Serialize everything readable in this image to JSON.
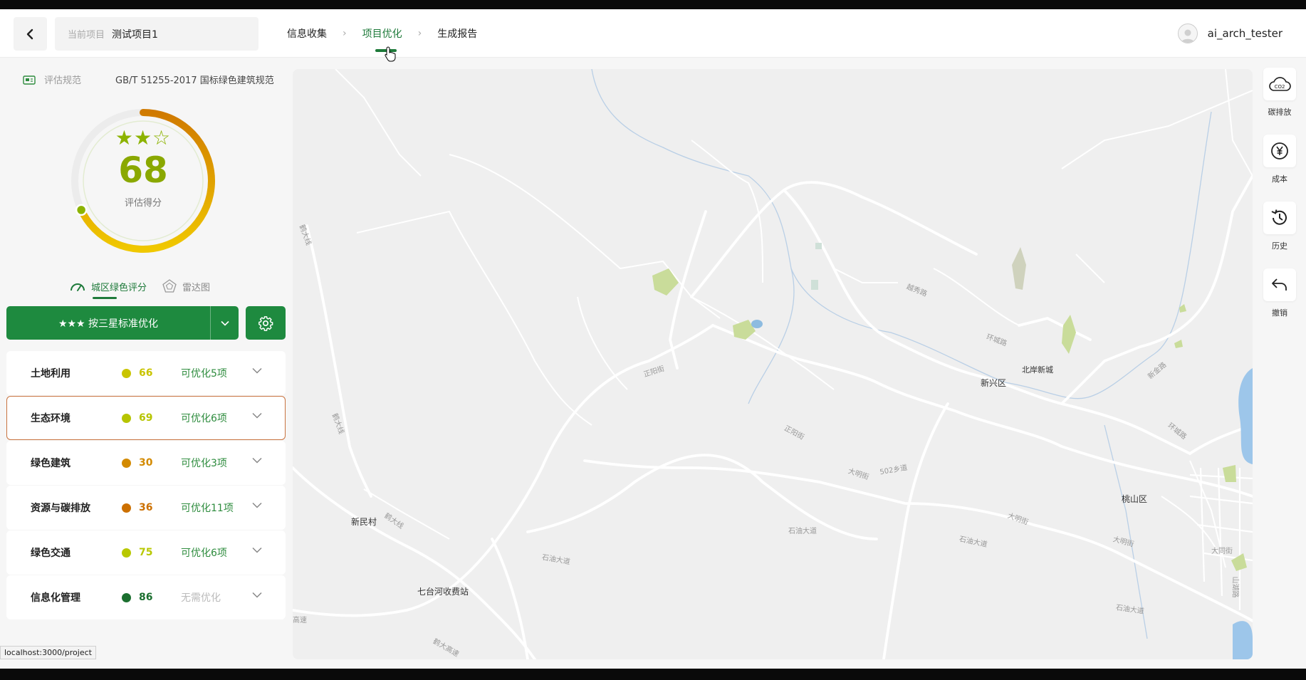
{
  "header": {
    "back_icon": "chevron-left-icon",
    "project_label": "当前项目",
    "project_name": "测试项目1",
    "steps": [
      {
        "label": "信息收集",
        "active": false
      },
      {
        "label": "项目优化",
        "active": true
      },
      {
        "label": "生成报告",
        "active": false
      }
    ],
    "username": "ai_arch_tester"
  },
  "standard": {
    "label": "评估规范",
    "value": "GB/T 51255-2017 国标绿色建筑规范"
  },
  "gauge": {
    "stars": "★★☆",
    "score": "68",
    "score_label": "评估得分",
    "score_fraction": 0.68
  },
  "view_tabs": [
    {
      "label": "城区绿色评分",
      "icon": "speedometer-icon",
      "active": true
    },
    {
      "label": "雷达图",
      "icon": "radar-icon",
      "active": false
    }
  ],
  "optimize_button": {
    "label": "★★★ 按三星标准优化"
  },
  "categories": [
    {
      "name": "土地利用",
      "score": "66",
      "status": "可优化5项",
      "dot_color": "#c9c400"
    },
    {
      "name": "生态环境",
      "score": "69",
      "status": "可优化6项",
      "dot_color": "#b6c400"
    },
    {
      "name": "绿色建筑",
      "score": "30",
      "status": "可优化3项",
      "dot_color": "#d38a00"
    },
    {
      "name": "资源与碳排放",
      "score": "36",
      "status": "可优化11项",
      "dot_color": "#cc7000"
    },
    {
      "name": "绿色交通",
      "score": "75",
      "status": "可优化6项",
      "dot_color": "#b8c800"
    },
    {
      "name": "信息化管理",
      "score": "86",
      "status": "无需优化",
      "dot_color": "#1b6f2f"
    }
  ],
  "selected_category": "生态环境",
  "map": {
    "labels": {
      "xinmincun": "新民村",
      "qitaihe": "七台河收费站",
      "xinxingqu": "新兴区",
      "beian": "北岸新城",
      "taoshan": "桃山区",
      "shiyou1": "石油大道",
      "shiyou2": "石油大道",
      "shiyou3": "石油大道",
      "shiyou4": "石油大道",
      "zhengyang1": "正阳街",
      "zhengyang2": "正阳街",
      "daming1": "大明街",
      "daming2": "大明街",
      "daming3": "大明街",
      "xiangdao": "502乡道",
      "huanchenglu1": "环城路",
      "huanchenglu2": "环城路",
      "xinjinlu": "新金路",
      "yuexiulu": "越秀路",
      "hedalu1": "鹤大线",
      "hedalu2": "鹤大线",
      "hedalu3": "鹤大线",
      "hedagaosu": "鹤大高速",
      "gaosu": "高速",
      "datongjie": "大同街",
      "shanhulu": "山湖路"
    }
  },
  "right_tools": [
    {
      "label": "碳排放",
      "icon": "co2-cloud-icon"
    },
    {
      "label": "成本",
      "icon": "yen-icon"
    },
    {
      "label": "历史",
      "icon": "history-icon"
    },
    {
      "label": "撤销",
      "icon": "undo-icon"
    }
  ],
  "status_url": "localhost:3000/project"
}
